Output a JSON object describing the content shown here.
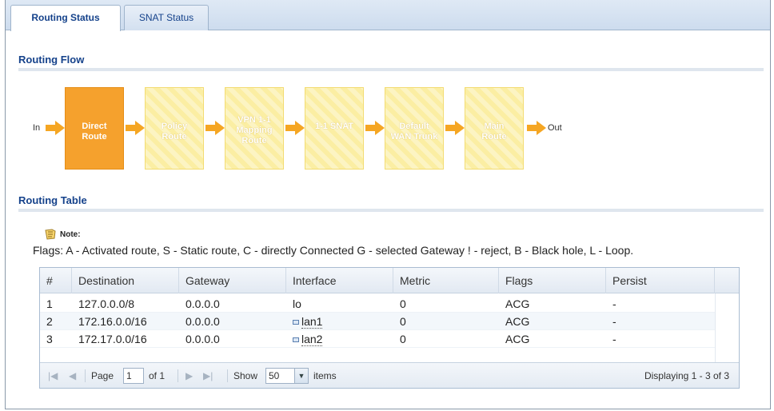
{
  "tabs": [
    {
      "label": "Routing Status"
    },
    {
      "label": "SNAT Status"
    }
  ],
  "routing_flow": {
    "title": "Routing Flow",
    "in_label": "In",
    "out_label": "Out",
    "steps": [
      {
        "label": "Direct\nRoute",
        "active": true
      },
      {
        "label": "Policy\nRoute",
        "active": false
      },
      {
        "label": "VPN 1-1\nMapping\nRoute",
        "active": false
      },
      {
        "label": "1-1 SNAT",
        "active": false
      },
      {
        "label": "Default\nWAN Trunk",
        "active": false
      },
      {
        "label": "Main\nRoute",
        "active": false
      }
    ]
  },
  "routing_table": {
    "title": "Routing Table",
    "note_label": "Note:",
    "flags_text": "Flags: A - Activated route, S - Static route, C - directly Connected G - selected Gateway ! - reject, B - Black hole, L - Loop.",
    "columns": [
      "#",
      "Destination",
      "Gateway",
      "Interface",
      "Metric",
      "Flags",
      "Persist"
    ],
    "rows": [
      {
        "num": "1",
        "destination": "127.0.0.0/8",
        "gateway": "0.0.0.0",
        "interface": "lo",
        "interface_link": false,
        "metric": "0",
        "flags": "ACG",
        "persist": "-"
      },
      {
        "num": "2",
        "destination": "172.16.0.0/16",
        "gateway": "0.0.0.0",
        "interface": "lan1",
        "interface_link": true,
        "metric": "0",
        "flags": "ACG",
        "persist": "-"
      },
      {
        "num": "3",
        "destination": "172.17.0.0/16",
        "gateway": "0.0.0.0",
        "interface": "lan2",
        "interface_link": true,
        "metric": "0",
        "flags": "ACG",
        "persist": "-"
      }
    ],
    "pager": {
      "page_label": "Page",
      "page_value": "1",
      "of_label": "of 1",
      "show_label": "Show",
      "show_value": "50",
      "items_label": "items",
      "displaying": "Displaying 1 - 3 of 3"
    }
  },
  "colors": {
    "accent_orange": "#f5a12d",
    "flow_box_inactive": "#fbeea3",
    "heading_blue": "#15428b"
  }
}
